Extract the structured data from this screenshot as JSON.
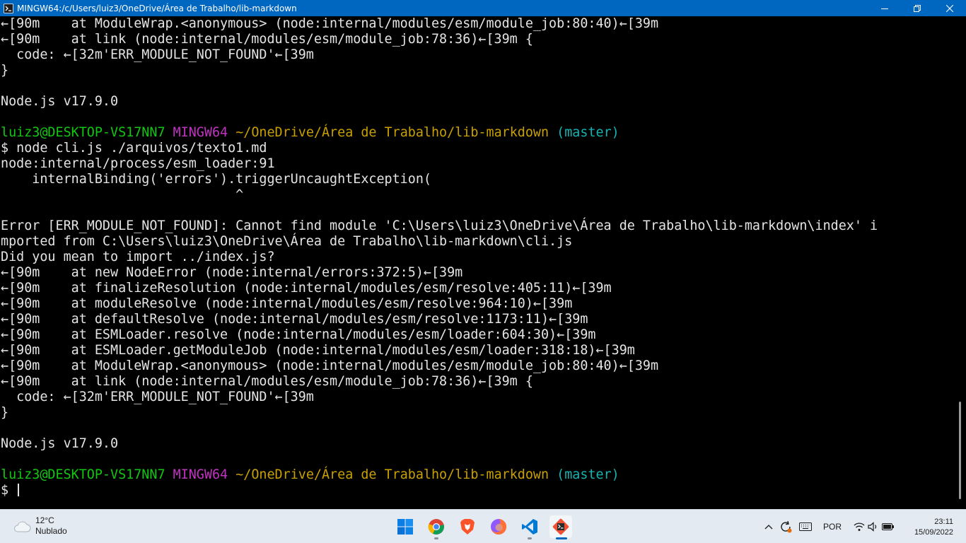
{
  "window": {
    "title": "MINGW64:/c/Users/luiz3/OneDrive/Área de Trabalho/lib-markdown",
    "colors": {
      "titlebar": "#0067c0",
      "background": "#000000",
      "text": "#e4e4e4",
      "user": "#12c712",
      "system": "#c232c2",
      "path": "#c8a000",
      "branch": "#11b5b5"
    }
  },
  "terminal": {
    "lines": [
      "←[90m    at ModuleWrap.<anonymous> (node:internal/modules/esm/module_job:80:40)←[39m",
      "←[90m    at link (node:internal/modules/esm/module_job:78:36)←[39m {",
      "  code: ←[32m'ERR_MODULE_NOT_FOUND'←[39m",
      "}",
      "",
      "Node.js v17.9.0",
      "",
      "$ node cli.js ./arquivos/texto1.md",
      "node:internal/process/esm_loader:91",
      "    internalBinding('errors').triggerUncaughtException(",
      "                              ^",
      "",
      "Error [ERR_MODULE_NOT_FOUND]: Cannot find module 'C:\\Users\\luiz3\\OneDrive\\Área de Trabalho\\lib-markdown\\index' i",
      "mported from C:\\Users\\luiz3\\OneDrive\\Área de Trabalho\\lib-markdown\\cli.js",
      "Did you mean to import ../index.js?",
      "←[90m    at new NodeError (node:internal/errors:372:5)←[39m",
      "←[90m    at finalizeResolution (node:internal/modules/esm/resolve:405:11)←[39m",
      "←[90m    at moduleResolve (node:internal/modules/esm/resolve:964:10)←[39m",
      "←[90m    at defaultResolve (node:internal/modules/esm/resolve:1173:11)←[39m",
      "←[90m    at ESMLoader.resolve (node:internal/modules/esm/loader:604:30)←[39m",
      "←[90m    at ESMLoader.getModuleJob (node:internal/modules/esm/loader:318:18)←[39m",
      "←[90m    at ModuleWrap.<anonymous> (node:internal/modules/esm/module_job:80:40)←[39m",
      "←[90m    at link (node:internal/modules/esm/module_job:78:36)←[39m {",
      "  code: ←[32m'ERR_MODULE_NOT_FOUND'←[39m",
      "}",
      "",
      "Node.js v17.9.0",
      "",
      "$ "
    ],
    "prompt": {
      "user": "luiz3@DESKTOP-VS17NN7",
      "system": "MINGW64",
      "path": "~/OneDrive/Área de Trabalho/lib-markdown",
      "branch": "(master)"
    }
  },
  "taskbar": {
    "weather": {
      "temperature": "12°C",
      "condition": "Nublado"
    },
    "apps": [
      {
        "name": "start-icon"
      },
      {
        "name": "chrome-icon"
      },
      {
        "name": "brave-icon"
      },
      {
        "name": "firefox-icon"
      },
      {
        "name": "vscode-icon"
      },
      {
        "name": "git-bash-icon"
      }
    ],
    "language": "POR",
    "time": "23:11",
    "date": "15/09/2022"
  }
}
